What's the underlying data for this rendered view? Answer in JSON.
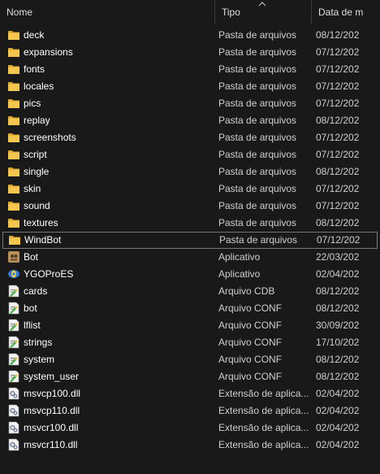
{
  "columns": {
    "name": "Nome",
    "type": "Tipo",
    "date": "Data de m"
  },
  "rows": [
    {
      "name": "deck",
      "type": "Pasta de arquivos",
      "date": "08/12/202",
      "icon": "folder-icon"
    },
    {
      "name": "expansions",
      "type": "Pasta de arquivos",
      "date": "07/12/202",
      "icon": "folder-icon"
    },
    {
      "name": "fonts",
      "type": "Pasta de arquivos",
      "date": "07/12/202",
      "icon": "folder-icon"
    },
    {
      "name": "locales",
      "type": "Pasta de arquivos",
      "date": "07/12/202",
      "icon": "folder-icon"
    },
    {
      "name": "pics",
      "type": "Pasta de arquivos",
      "date": "07/12/202",
      "icon": "folder-icon"
    },
    {
      "name": "replay",
      "type": "Pasta de arquivos",
      "date": "08/12/202",
      "icon": "folder-icon"
    },
    {
      "name": "screenshots",
      "type": "Pasta de arquivos",
      "date": "07/12/202",
      "icon": "folder-icon"
    },
    {
      "name": "script",
      "type": "Pasta de arquivos",
      "date": "07/12/202",
      "icon": "folder-icon"
    },
    {
      "name": "single",
      "type": "Pasta de arquivos",
      "date": "08/12/202",
      "icon": "folder-icon"
    },
    {
      "name": "skin",
      "type": "Pasta de arquivos",
      "date": "07/12/202",
      "icon": "folder-icon"
    },
    {
      "name": "sound",
      "type": "Pasta de arquivos",
      "date": "07/12/202",
      "icon": "folder-icon"
    },
    {
      "name": "textures",
      "type": "Pasta de arquivos",
      "date": "08/12/202",
      "icon": "folder-icon"
    },
    {
      "name": "WindBot",
      "type": "Pasta de arquivos",
      "date": "07/12/202",
      "icon": "folder-icon",
      "selected": true
    },
    {
      "name": "Bot",
      "type": "Aplicativo",
      "date": "22/03/202",
      "icon": "bot-app-icon"
    },
    {
      "name": "YGOProES",
      "type": "Aplicativo",
      "date": "02/04/202",
      "icon": "ygopro-app-icon"
    },
    {
      "name": "cards",
      "type": "Arquivo CDB",
      "date": "08/12/202",
      "icon": "data-file-icon"
    },
    {
      "name": "bot",
      "type": "Arquivo CONF",
      "date": "08/12/202",
      "icon": "data-file-icon"
    },
    {
      "name": "lflist",
      "type": "Arquivo CONF",
      "date": "30/09/202",
      "icon": "data-file-icon"
    },
    {
      "name": "strings",
      "type": "Arquivo CONF",
      "date": "17/10/202",
      "icon": "data-file-icon"
    },
    {
      "name": "system",
      "type": "Arquivo CONF",
      "date": "08/12/202",
      "icon": "data-file-icon"
    },
    {
      "name": "system_user",
      "type": "Arquivo CONF",
      "date": "08/12/202",
      "icon": "data-file-icon"
    },
    {
      "name": "msvcp100.dll",
      "type": "Extensão de aplica...",
      "date": "02/04/202",
      "icon": "dll-file-icon"
    },
    {
      "name": "msvcp110.dll",
      "type": "Extensão de aplica...",
      "date": "02/04/202",
      "icon": "dll-file-icon"
    },
    {
      "name": "msvcr100.dll",
      "type": "Extensão de aplica...",
      "date": "02/04/202",
      "icon": "dll-file-icon"
    },
    {
      "name": "msvcr110.dll",
      "type": "Extensão de aplica...",
      "date": "02/04/202",
      "icon": "dll-file-icon"
    }
  ],
  "colors": {
    "background": "#191919",
    "folder": "#f0c24a",
    "selection_border": "#777777"
  }
}
